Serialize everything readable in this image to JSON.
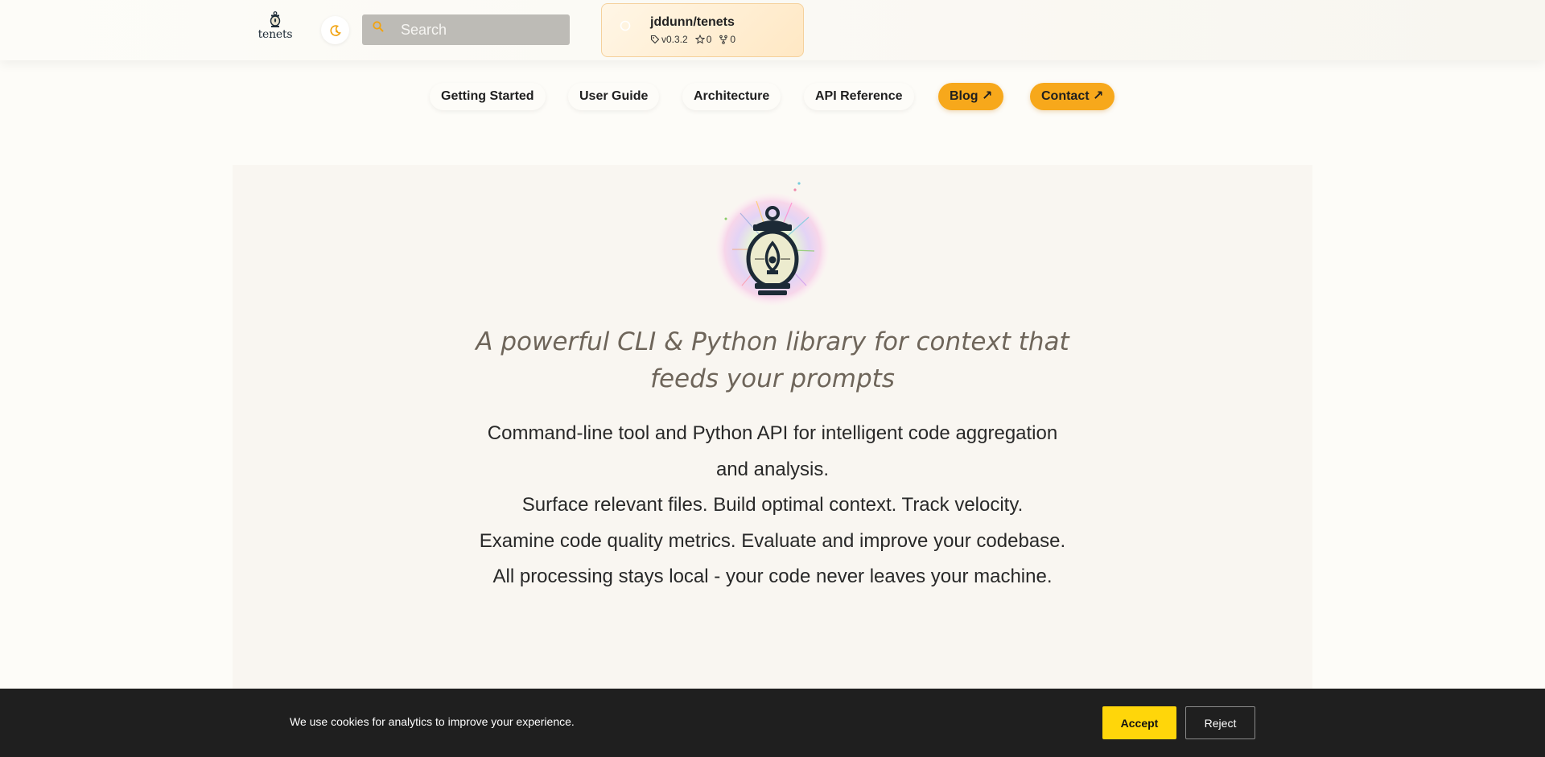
{
  "header": {
    "logo_text": "tenets",
    "search_placeholder": "Search",
    "repo": {
      "name": "jddunn/tenets",
      "version": "v0.3.2",
      "stars": "0",
      "forks": "0"
    }
  },
  "nav": {
    "items": [
      {
        "label": "Getting Started"
      },
      {
        "label": "User Guide"
      },
      {
        "label": "Architecture"
      },
      {
        "label": "API Reference"
      },
      {
        "label": "Blog ↗"
      },
      {
        "label": "Contact ↗"
      }
    ]
  },
  "hero": {
    "tagline": "A powerful CLI & Python library for context that feeds your prompts",
    "lines": [
      "Command-line tool and Python API for intelligent code aggregation and analysis.",
      "Surface relevant files. Build optimal context. Track velocity.",
      "Examine code quality metrics. Evaluate and improve your codebase.",
      "All processing stays local - your code never leaves your machine."
    ]
  },
  "cookie": {
    "text": "We use cookies for analytics to improve your experience.",
    "accept": "Accept",
    "reject": "Reject"
  },
  "colors": {
    "accent": "#f7a81b",
    "accept": "#ffd60a",
    "cookie_bg": "#1f1f1f"
  }
}
